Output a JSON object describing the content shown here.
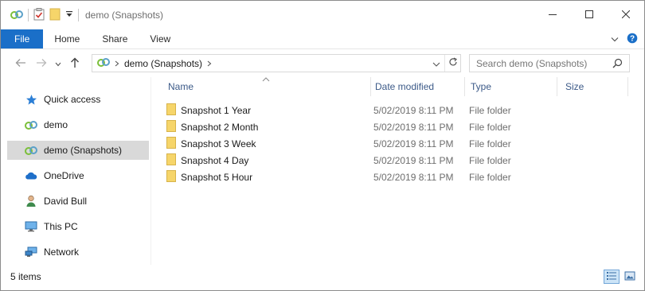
{
  "window": {
    "title": "demo (Snapshots)",
    "controls": {
      "minimize": "minimize-icon",
      "maximize": "maximize-icon",
      "close": "close-icon"
    }
  },
  "ribbon": {
    "tabs": [
      {
        "label": "File"
      },
      {
        "label": "Home"
      },
      {
        "label": "Share"
      },
      {
        "label": "View"
      }
    ]
  },
  "address": {
    "path": "demo (Snapshots)"
  },
  "search": {
    "placeholder": "Search demo (Snapshots)"
  },
  "sidebar": {
    "items": [
      {
        "label": "Quick access",
        "icon": "star-icon"
      },
      {
        "label": "demo",
        "icon": "sync-cloud-icon"
      },
      {
        "label": "demo (Snapshots)",
        "icon": "sync-cloud-icon",
        "selected": true
      },
      {
        "label": "OneDrive",
        "icon": "onedrive-icon"
      },
      {
        "label": "David Bull",
        "icon": "user-icon"
      },
      {
        "label": "This PC",
        "icon": "computer-icon"
      },
      {
        "label": "Network",
        "icon": "network-icon"
      }
    ]
  },
  "columns": {
    "name": "Name",
    "date": "Date modified",
    "type": "Type",
    "size": "Size"
  },
  "files": [
    {
      "name": "Snapshot 1 Year",
      "date": "5/02/2019 8:11 PM",
      "type": "File folder"
    },
    {
      "name": "Snapshot 2 Month",
      "date": "5/02/2019 8:11 PM",
      "type": "File folder"
    },
    {
      "name": "Snapshot 3 Week",
      "date": "5/02/2019 8:11 PM",
      "type": "File folder"
    },
    {
      "name": "Snapshot 4 Day",
      "date": "5/02/2019 8:11 PM",
      "type": "File folder"
    },
    {
      "name": "Snapshot 5 Hour",
      "date": "5/02/2019 8:11 PM",
      "type": "File folder"
    }
  ],
  "status": {
    "items_count": "5 items"
  },
  "colors": {
    "file_tab": "#1a6fc8",
    "column_header": "#3c5a88",
    "selected_nav": "#d9d9d9",
    "folder": "#f6d56a"
  }
}
